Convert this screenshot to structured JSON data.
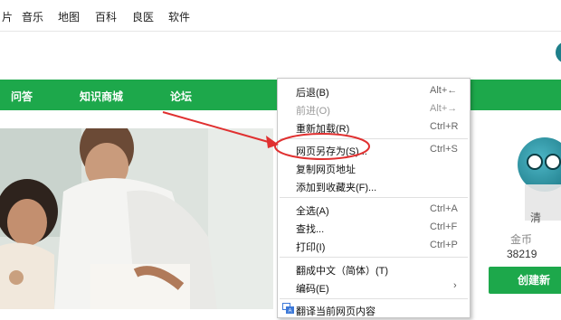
{
  "top_nav": {
    "items": [
      "片",
      "音乐",
      "地图",
      "百科",
      "良医",
      "软件"
    ]
  },
  "green_nav": {
    "items": [
      "问答",
      "知识商城",
      "论坛"
    ]
  },
  "sidebar": {
    "username": "清",
    "coins_label": "金币",
    "coins_value": "38219",
    "create_button": "创建新"
  },
  "context_menu": {
    "items": [
      {
        "label": "后退(B)",
        "shortcut": "Alt+←",
        "disabled": false
      },
      {
        "label": "前进(O)",
        "shortcut": "Alt+→",
        "disabled": true
      },
      {
        "label": "重新加载(R)",
        "shortcut": "Ctrl+R",
        "disabled": false
      },
      {
        "label": "网页另存为(S)...",
        "shortcut": "Ctrl+S",
        "disabled": false
      },
      {
        "label": "复制网页地址",
        "shortcut": "",
        "disabled": false
      },
      {
        "label": "添加到收藏夹(F)...",
        "shortcut": "",
        "disabled": false
      },
      {
        "label": "全选(A)",
        "shortcut": "Ctrl+A",
        "disabled": false
      },
      {
        "label": "查找...",
        "shortcut": "Ctrl+F",
        "disabled": false
      },
      {
        "label": "打印(I)",
        "shortcut": "Ctrl+P",
        "disabled": false
      },
      {
        "label": "翻成中文（简体）(T)",
        "shortcut": "",
        "disabled": false
      },
      {
        "label": "编码(E)",
        "shortcut": "",
        "disabled": false,
        "submenu": true
      },
      {
        "label": "翻译当前网页内容",
        "shortcut": "",
        "disabled": false,
        "icon": "translate-icon"
      }
    ]
  },
  "colors": {
    "green": "#1da84b",
    "annotation_red": "#e03030"
  }
}
